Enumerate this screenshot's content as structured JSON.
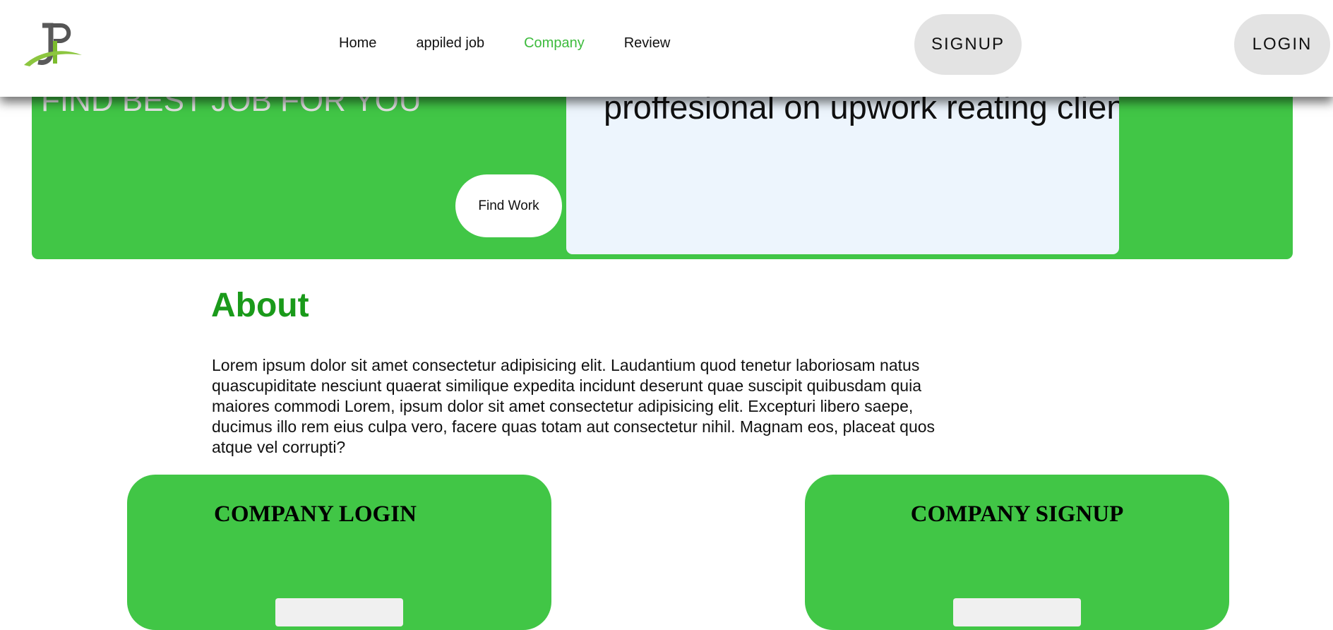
{
  "nav": {
    "links": [
      "Home",
      "appiled job",
      "Company",
      "Review"
    ],
    "active_link": "Company",
    "signup_label": "SIGNUP",
    "login_label": "LOGIN"
  },
  "hero": {
    "title": "FIND BEST JOB FOR YOU",
    "find_work_label": "Find Work",
    "review_text": "proffesional on upwork reating client"
  },
  "about": {
    "heading": "About",
    "body": "Lorem ipsum dolor sit amet consectetur adipisicing elit. Laudantium quod tenetur laboriosam natus quascupiditate nesciunt quaerat similique expedita incidunt deserunt quae suscipit quibusdam quia maiores commodi Lorem, ipsum dolor sit amet consectetur adipisicing elit. Excepturi libero saepe, ducimus illo rem eius culpa vero, facere quas totam aut consectetur nihil. Magnam eos, placeat quos atque vel corrupti?"
  },
  "company_login": {
    "title": "COMPANY LOGIN"
  },
  "company_signup": {
    "title": "COMPANY SIGNUP"
  },
  "colors": {
    "brand_green": "#41c646",
    "heading_green": "#1a9a1a",
    "active_link": "#3dbb3d",
    "review_card_bg": "#edf5fd",
    "pill_button_bg": "#e3e3e3"
  },
  "icons": {
    "logo": "jp-logo"
  }
}
